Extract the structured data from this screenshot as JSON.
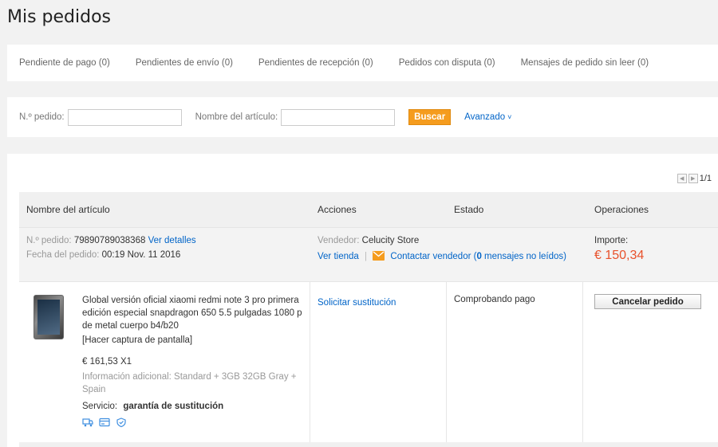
{
  "page_title": "Mis pedidos",
  "tabs": [
    "Pendiente de pago (0)",
    "Pendientes de envío (0)",
    "Pendientes de recepción (0)",
    "Pedidos con disputa (0)",
    "Mensajes de pedido sin leer (0)"
  ],
  "search": {
    "order_label": "N.º pedido:",
    "order_value": "",
    "item_label": "Nombre del artículo:",
    "item_value": "",
    "search_button": "Buscar",
    "advanced_link": "Avanzado",
    "advanced_chevron": "˅"
  },
  "pager": {
    "text": "1/1",
    "prev": "◀",
    "next": "▶"
  },
  "table_headers": {
    "item": "Nombre del artículo",
    "actions": "Acciones",
    "status": "Estado",
    "operations": "Operaciones"
  },
  "order": {
    "number_label": "N.º pedido:",
    "number": "79890789038368",
    "details_link": "Ver detalles",
    "date_label": "Fecha del pedido:",
    "date": "00:19 Nov. 11 2016",
    "seller_label": "Vendedor:",
    "seller": "Celucity Store",
    "store_link": "Ver tienda",
    "separator": "|",
    "contact_prefix": "Contactar vendedor (",
    "contact_count": "0",
    "contact_suffix": " mensajes no leídos)",
    "amount_label": "Importe:",
    "amount": "€ 150,34"
  },
  "item": {
    "title": "Global versión oficial xiaomi redmi note 3 pro primera edición especial snapdragon 650 5.5 pulgadas 1080 p de metal cuerpo b4/b20",
    "screenshot_link": "[Hacer captura de pantalla]",
    "price": "€ 161,53 X1",
    "extra_info": "Información adicional: Standard + 3GB 32GB Gray + Spain",
    "service_label": "Servicio:",
    "service_value": "garantía de sustitución",
    "action_link": "Solicitar sustitución",
    "status": "Comprobando pago",
    "cancel_button": "Cancelar pedido"
  },
  "colors": {
    "accent": "#f59c1e",
    "link": "#0064c8",
    "amount": "#e8512b"
  }
}
